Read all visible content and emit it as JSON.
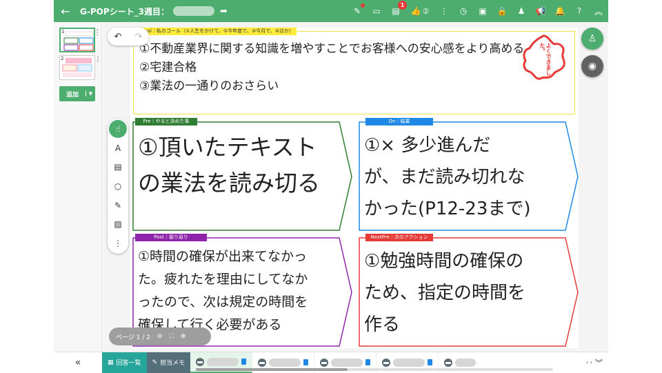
{
  "header": {
    "back_icon": "arrow-left-icon",
    "title": "G-POPシート_3週目：",
    "notification_count": "1",
    "reaction_count": "②"
  },
  "sidebar": {
    "page_numbers": [
      "1",
      "2"
    ],
    "add_label": "追加"
  },
  "goal": {
    "tag": "Goal｜私のゴール（①人生をかけて、②今年度で、③今月で、④ほか）",
    "lines": [
      "①不動産業界に関する知識を増やすことでお客様への安心感をより高める",
      "②宅建合格",
      "③業法の一通りのおさらい"
    ],
    "stamp_text": "よくできました。"
  },
  "cards": {
    "pre": {
      "tag": "Pre｜やると決めた事",
      "lines": [
        "①頂いたテキスト",
        "の業法を読み切る"
      ],
      "color": "#2e7d32"
    },
    "on": {
      "tag": "On｜結果",
      "lines": [
        "①× 多少進んだ",
        "が、まだ読み切れな",
        "かった(P12-23まで)"
      ],
      "color": "#1e88e5"
    },
    "post": {
      "tag": "Post｜振り返り",
      "lines": [
        "①時間の確保が出来てなかっ",
        "た。疲れたを理由にしてなか",
        "ったので、次は規定の時間を",
        "確保して行く必要がある"
      ],
      "color": "#8e24aa"
    },
    "nextpre": {
      "tag": "NextPre｜次のアクション",
      "lines": [
        "①勉強時間の確保の",
        "ため、指定の時間を",
        "作る"
      ],
      "color": "#e53935"
    }
  },
  "pager": {
    "label": "ページ 1 / 2"
  },
  "bottom": {
    "answers_tab": "回答一覧",
    "memo_tab": "担当メモ"
  },
  "colors": {
    "brand_green": "#4cad6f",
    "teal_tab": "#26a69a",
    "memo_tab": "#546e7a",
    "fab_dark": "#616161"
  }
}
